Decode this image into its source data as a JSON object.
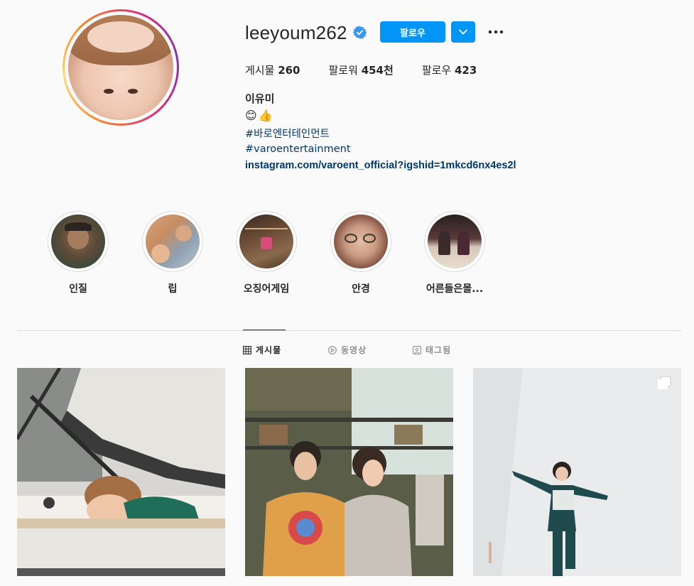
{
  "profile": {
    "username": "leeyoum262",
    "follow_label": "팔로우",
    "stats": {
      "posts_label": "게시물",
      "posts_value": "260",
      "followers_label": "팔로워",
      "followers_value": "454천",
      "following_label": "팔로우",
      "following_value": "423"
    },
    "bio": {
      "name": "이유미",
      "emoji": [
        "😊",
        "👍"
      ],
      "hashtag_ko": "#바로엔터테인먼트",
      "hashtag_en": "#varoentertainment",
      "link": "instagram.com/varoent_official?igshid=1mkcd6nx4es2l"
    }
  },
  "highlights": [
    {
      "label": "인질"
    },
    {
      "label": "립"
    },
    {
      "label": "오징어게임"
    },
    {
      "label": "안경"
    },
    {
      "label": "어른들은몰..."
    }
  ],
  "tabs": {
    "posts": "게시물",
    "videos": "동영상",
    "tagged": "태그됨"
  },
  "icons": {
    "verified": "verified-badge-icon",
    "dropdown": "chevron-down-icon",
    "more": "more-options-icon",
    "grid": "grid-icon",
    "video": "video-play-icon",
    "tagged": "tagged-person-icon",
    "multi": "multiple-images-icon"
  },
  "colors": {
    "accent": "#0095f6",
    "link": "#00376b"
  }
}
